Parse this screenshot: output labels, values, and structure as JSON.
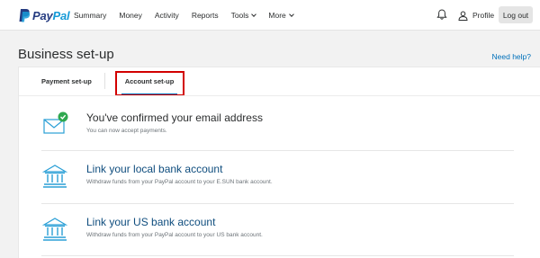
{
  "brand": {
    "pay": "Pay",
    "pal": "Pal"
  },
  "nav": {
    "items": [
      {
        "label": "Summary"
      },
      {
        "label": "Money"
      },
      {
        "label": "Activity"
      },
      {
        "label": "Reports"
      },
      {
        "label": "Tools"
      },
      {
        "label": "More"
      }
    ],
    "profile_label": "Profile",
    "logout_label": "Log out"
  },
  "page": {
    "title": "Business set-up",
    "help_link": "Need help?"
  },
  "tabs": [
    {
      "label": "Payment set-up"
    },
    {
      "label": "Account set-up",
      "active": true
    }
  ],
  "rows": [
    {
      "icon": "envelope-check-icon",
      "title": "You've confirmed your email address",
      "subtitle": "You can now accept payments."
    },
    {
      "icon": "bank-icon",
      "title": "Link your local bank account",
      "subtitle": "Withdraw funds from your PayPal account to your E.SUN bank account."
    },
    {
      "icon": "bank-icon",
      "title": "Link your US bank account",
      "subtitle": "Withdraw funds from your PayPal account to your US bank account."
    }
  ],
  "colors": {
    "accent": "#0070ba",
    "highlight_border": "#d20000",
    "success": "#2fa84f",
    "icon_blue": "#2a9fd6"
  }
}
